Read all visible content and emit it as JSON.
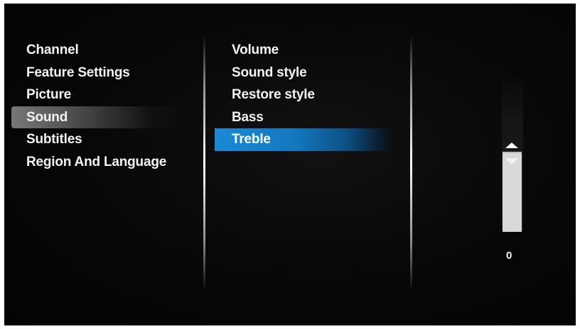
{
  "settings_menu": {
    "items": [
      {
        "label": "Channel"
      },
      {
        "label": "Feature Settings"
      },
      {
        "label": "Picture"
      },
      {
        "label": "Sound"
      },
      {
        "label": "Subtitles"
      },
      {
        "label": "Region And Language"
      }
    ],
    "active": "Sound"
  },
  "sound_menu": {
    "items": [
      {
        "label": "Volume"
      },
      {
        "label": "Sound style"
      },
      {
        "label": "Restore style"
      },
      {
        "label": "Bass"
      },
      {
        "label": "Treble"
      }
    ],
    "selected": "Treble"
  },
  "treble_slider": {
    "value": "0",
    "up_icon": "triangle-up-icon",
    "down_icon": "triangle-down-icon"
  },
  "colors": {
    "background": "#050505",
    "selection": "#1a8ad6",
    "active_parent": "#6a6a6a",
    "text": "#f2f2f2"
  }
}
